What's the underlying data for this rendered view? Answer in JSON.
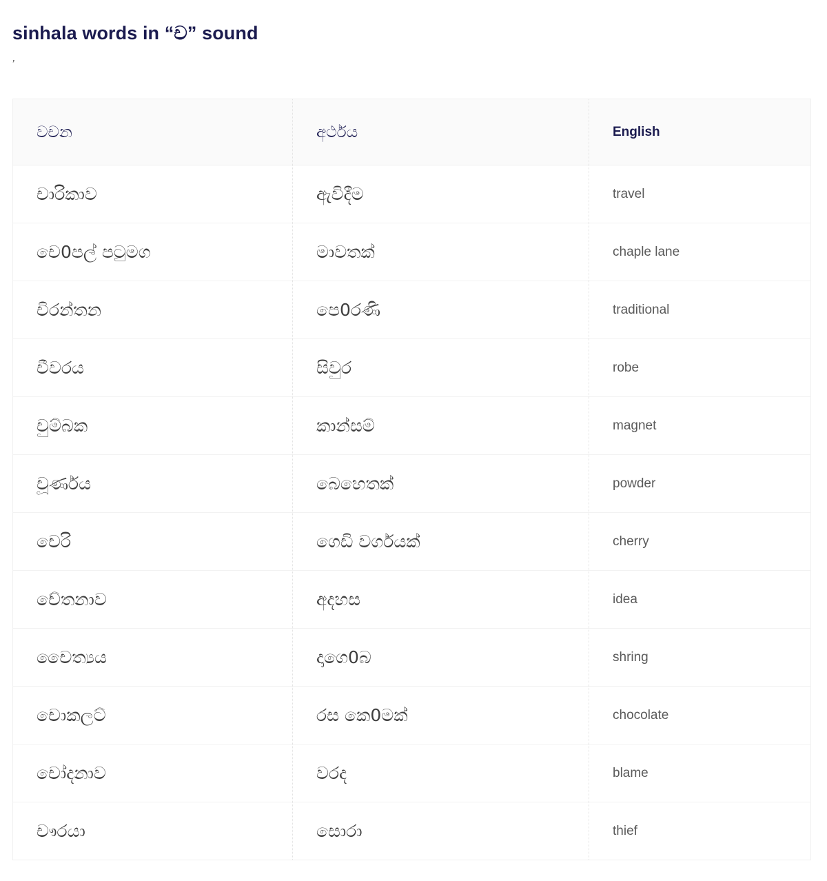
{
  "page": {
    "title_prefix": "sinhala words in “",
    "title_letter": "ච",
    "title_suffix": "” sound",
    "title_full": "sinhala words in “ච” sound",
    "sub_mark": "’",
    "title_color": "#1b1b4f",
    "background_color": "#ffffff"
  },
  "table": {
    "headers": {
      "word": "වචන",
      "meaning": "අර්ථය",
      "english": "English"
    },
    "header_bg": "#fafafa",
    "border_color": "#f0f0f0",
    "divider_color": "#e3e3e3",
    "rows": [
      {
        "word": "චාරිකාව",
        "meaning": "ඇවිදීම",
        "english": "travel"
      },
      {
        "word": "චෙ0පල් පටුමග",
        "meaning": "මාවතක්",
        "english": "chaple lane"
      },
      {
        "word": "චිරන්තන",
        "meaning": "පෙ0රණි",
        "english": "traditional"
      },
      {
        "word": "චීවරය",
        "meaning": "සිවුර",
        "english": "robe"
      },
      {
        "word": "චුම්බක",
        "meaning": "කාන්සම්",
        "english": "magnet"
      },
      {
        "word": "චූර්ණය",
        "meaning": "බෙහෙතක්",
        "english": "powder"
      },
      {
        "word": "චෙරි",
        "meaning": "ගෙඩි වර්ගයක්",
        "english": "cherry"
      },
      {
        "word": "චේතනාව",
        "meaning": "අදහස",
        "english": "idea"
      },
      {
        "word": "චෛත්‍යය",
        "meaning": "දාගෙ0බ",
        "english": "shring"
      },
      {
        "word": "චොකලට්",
        "meaning": "රස කෙ0මක්",
        "english": "chocolate"
      },
      {
        "word": "චෝදනාව",
        "meaning": "වරද",
        "english": "blame"
      },
      {
        "word": "චෟරයා",
        "meaning": "සොරා",
        "english": "thief"
      }
    ]
  }
}
